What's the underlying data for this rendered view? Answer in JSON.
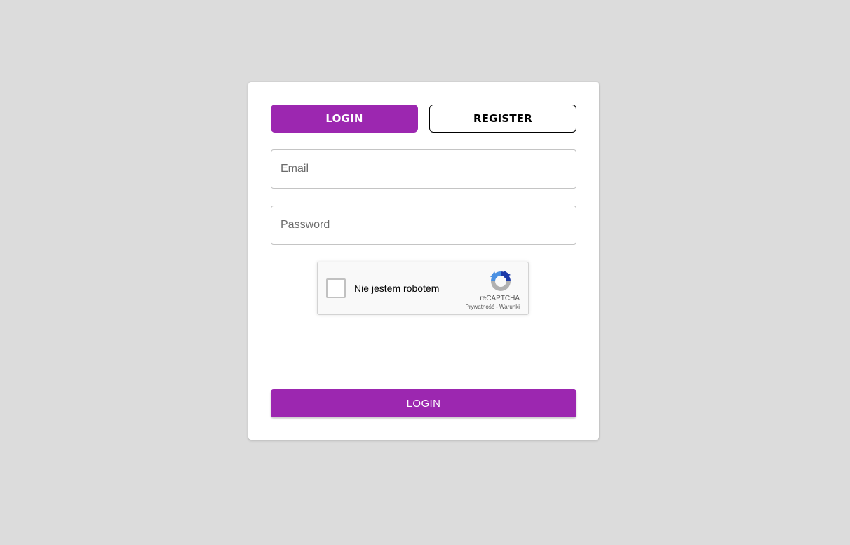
{
  "tabs": {
    "login_label": "LOGIN",
    "register_label": "REGISTER"
  },
  "form": {
    "email_placeholder": "Email",
    "email_value": "",
    "password_placeholder": "Password",
    "password_value": "",
    "submit_label": "LOGIN"
  },
  "captcha": {
    "label": "Nie jestem robotem",
    "brand": "reCAPTCHA",
    "privacy_link": "Prywatność",
    "separator": " - ",
    "terms_link": "Warunki",
    "logo_icon": "recaptcha-icon"
  },
  "colors": {
    "accent": "#9c27b0",
    "background": "#dcdcdc",
    "card": "#ffffff"
  }
}
